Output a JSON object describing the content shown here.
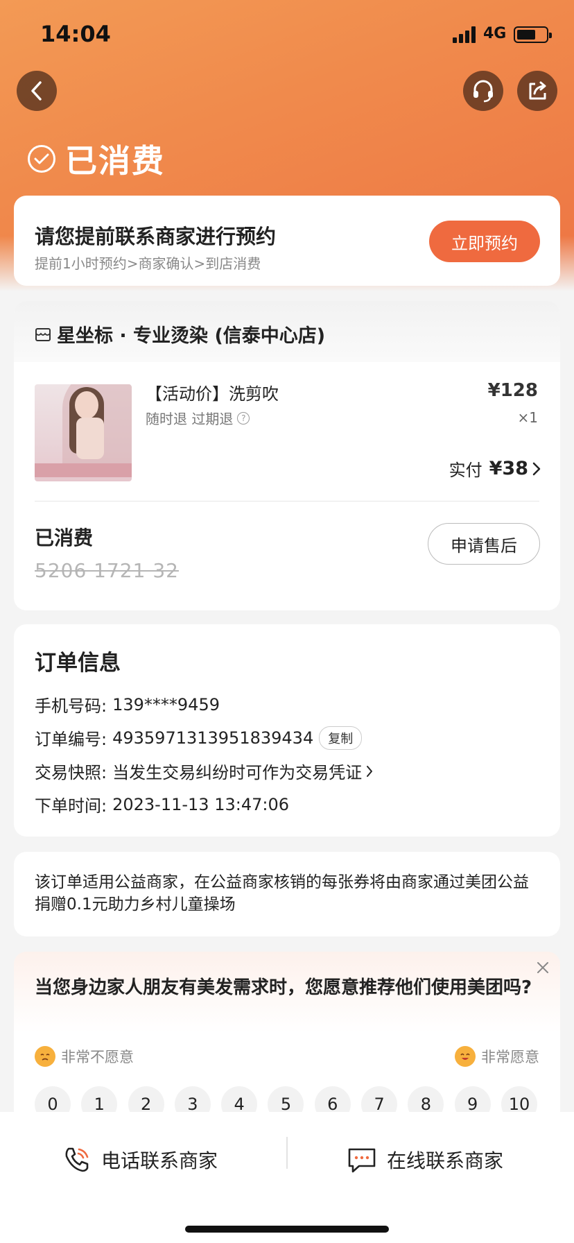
{
  "status_bar": {
    "time": "14:04",
    "network": "4G"
  },
  "header": {
    "state_title": "已消费"
  },
  "booking": {
    "title": "请您提前联系商家进行预约",
    "subtitle": "提前1小时预约>商家确认>到店消费",
    "button_label": "立即预约"
  },
  "shop": {
    "name": "星坐标 · 专业烫染 (信泰中心店)",
    "item_name": "【活动价】洗剪吹",
    "tags": "随时退 过期退",
    "price": "¥128",
    "quantity": "×1",
    "paid_label": "实付",
    "paid_amount": "¥38",
    "status": "已消费",
    "voucher_code": "5206 1721 32",
    "after_sale_button": "申请售后"
  },
  "order_info": {
    "title": "订单信息",
    "rows": [
      {
        "label": "手机号码:",
        "value": "139****9459"
      },
      {
        "label": "订单编号:",
        "value": "4935971313951839434"
      },
      {
        "label": "交易快照:",
        "value": "当发生交易纠纷时可作为交易凭证"
      },
      {
        "label": "下单时间:",
        "value": "2023-11-13 13:47:06"
      }
    ],
    "copy_label": "复制"
  },
  "charity": {
    "text": "该订单适用公益商家，在公益商家核销的每张券将由商家通过美团公益捐赠0.1元助力乡村儿童操场"
  },
  "survey": {
    "question": "当您身边家人朋友有美发需求时，您愿意推荐他们使用美团吗?",
    "low_label": "非常不愿意",
    "high_label": "非常愿意",
    "scores": [
      "0",
      "1",
      "2",
      "3",
      "4",
      "5",
      "6",
      "7",
      "8",
      "9",
      "10"
    ]
  },
  "bottom_bar": {
    "phone_label": "电话联系商家",
    "chat_label": "在线联系商家"
  },
  "colors": {
    "accent": "#ef6a3f",
    "hero_start": "#f39a55",
    "hero_end": "#ed7443"
  }
}
